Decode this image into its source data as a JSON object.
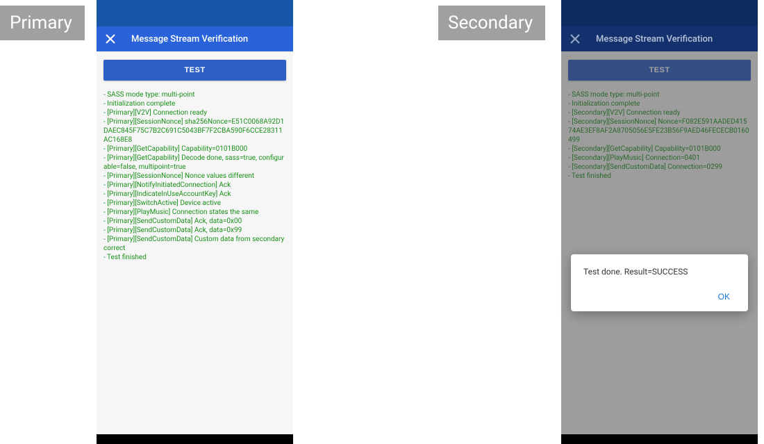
{
  "labels": {
    "primary": "Primary",
    "secondary": "Secondary"
  },
  "app": {
    "title": "Message Stream Verification",
    "test_button": "TEST"
  },
  "primary_log": [
    " - SASS mode type: multi-point",
    " - Initialization complete",
    " - [Primary][V2V] Connection ready",
    " - [Primary][SessionNonce] sha256Nonce=E51C0068A92D1DAEC845F75C7B2C691C5043BF7F2CBA590F6CCE28311AC168E8",
    " - [Primary][GetCapability] Capability=0101B000",
    " - [Primary][GetCapability] Decode done, sass=true, configurable=false, multipoint=true",
    " - [Primary][SessionNonce] Nonce values different",
    " - [Primary][NotifyInitiatedConnection] Ack",
    " - [Primary][IndicateInUseAccountKey] Ack",
    " - [Primary][SwitchActive] Device active",
    " - [Primary][PlayMusic] Connection states the same",
    " - [Primary][SendCustomData] Ack, data=0x00",
    " - [Primary][SendCustomData] Ack, data=0x99",
    " - [Primary][SendCustomData] Custom data from secondary correct",
    " - Test finished"
  ],
  "secondary_log": [
    " - SASS mode type: multi-point",
    " - Initialization complete",
    " - [Secondary][V2V] Connection ready",
    " - [Secondary][SessionNonce] Nonce=F082E591AADED41574AE3EF8AF2A8705056E5FE23B56F9AED46FECECB0160499",
    " - [Secondary][GetCapability] Capability=0101B000",
    " - [Secondary][PlayMusic] Connection=0401",
    " - [Secondary][SendCustomData] Connection=0299",
    " - Test finished"
  ],
  "dialog": {
    "message": "Test done. Result=SUCCESS",
    "ok": "OK"
  }
}
